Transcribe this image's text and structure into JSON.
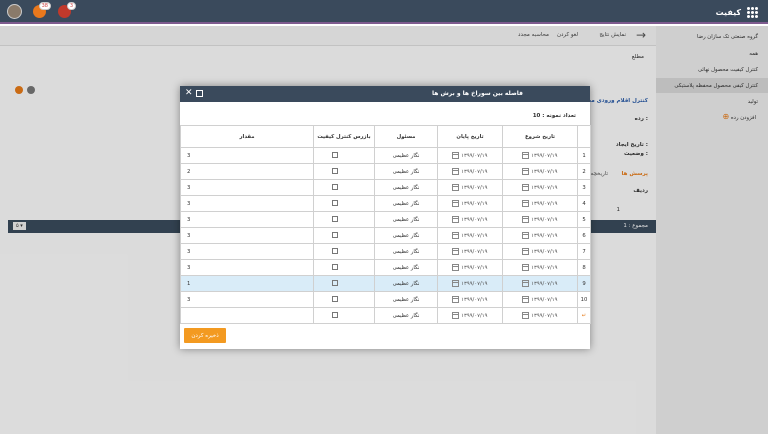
{
  "header": {
    "brand": "کیفیت",
    "notif_badge_1": "38",
    "notif_badge_2": "3"
  },
  "toolbar": {
    "back": "→",
    "show_results": "نمایش نتایج",
    "cancel": "لغو کردن",
    "recalc": "محاسبه مجدد"
  },
  "breadcrumb": "مطلع",
  "sidebar": {
    "group": "گروه صنعتی تک سازان رضا",
    "all": "همه",
    "item1": "کنترل کیفیت محصول نهائی",
    "item2": "کنترل کیفی محصول محفظه پلاستیکی",
    "production": "تولید",
    "add": "افزودن رده"
  },
  "background": {
    "form_title": "کنترل اقلام ورودی محفظه",
    "grade": "رده :",
    "created": "تاریخ ایجاد :",
    "status": "وضعیت :",
    "tab": "پرسش ها",
    "tab2": "تاریخچه",
    "col_row": "ردیف",
    "row_val": "1",
    "total": "مجموع : 1",
    "pager": "۵ ▾"
  },
  "modal": {
    "title": "فاصله بین سوراخ ها و برش ها",
    "sample_count": "تعداد نمونه : 10",
    "columns": [
      "تاریخ شروع",
      "تاریخ پایان",
      "مسئول",
      "بازرس کنترل کیفیت",
      "مقدار"
    ],
    "rows": [
      {
        "n": "1",
        "start": "۱۳۹۹/۰۷/۱۹",
        "end": "۱۳۹۹/۰۷/۱۹",
        "resp": "نگار عظیمی",
        "qty": "3"
      },
      {
        "n": "2",
        "start": "۱۳۹۹/۰۷/۱۹",
        "end": "۱۳۹۹/۰۷/۱۹",
        "resp": "نگار عظیمی",
        "qty": "2"
      },
      {
        "n": "3",
        "start": "۱۳۹۹/۰۷/۱۹",
        "end": "۱۳۹۹/۰۷/۱۹",
        "resp": "نگار عظیمی",
        "qty": "3"
      },
      {
        "n": "4",
        "start": "۱۳۹۹/۰۷/۱۹",
        "end": "۱۳۹۹/۰۷/۱۹",
        "resp": "نگار عظیمی",
        "qty": "3"
      },
      {
        "n": "5",
        "start": "۱۳۹۹/۰۷/۱۹",
        "end": "۱۳۹۹/۰۷/۱۹",
        "resp": "نگار عظیمی",
        "qty": "3"
      },
      {
        "n": "6",
        "start": "۱۳۹۹/۰۷/۱۹",
        "end": "۱۳۹۹/۰۷/۱۹",
        "resp": "نگار عظیمی",
        "qty": "3"
      },
      {
        "n": "7",
        "start": "۱۳۹۹/۰۷/۱۹",
        "end": "۱۳۹۹/۰۷/۱۹",
        "resp": "نگار عظیمی",
        "qty": "3"
      },
      {
        "n": "8",
        "start": "۱۳۹۹/۰۷/۱۹",
        "end": "۱۳۹۹/۰۷/۱۹",
        "resp": "نگار عظیمی",
        "qty": "3"
      },
      {
        "n": "9",
        "start": "۱۳۹۹/۰۷/۱۹",
        "end": "۱۳۹۹/۰۷/۱۹",
        "resp": "نگار عظیمی",
        "qty": "1"
      },
      {
        "n": "10",
        "start": "۱۳۹۹/۰۷/۱۹",
        "end": "۱۳۹۹/۰۷/۱۹",
        "resp": "نگار عظیمی",
        "qty": "3"
      },
      {
        "n": "↵",
        "start": "۱۳۹۹/۰۷/۱۹",
        "end": "۱۳۹۹/۰۷/۱۹",
        "resp": "نگار عظیمی",
        "qty": ""
      }
    ],
    "save_label": "ذخیره کردن"
  }
}
